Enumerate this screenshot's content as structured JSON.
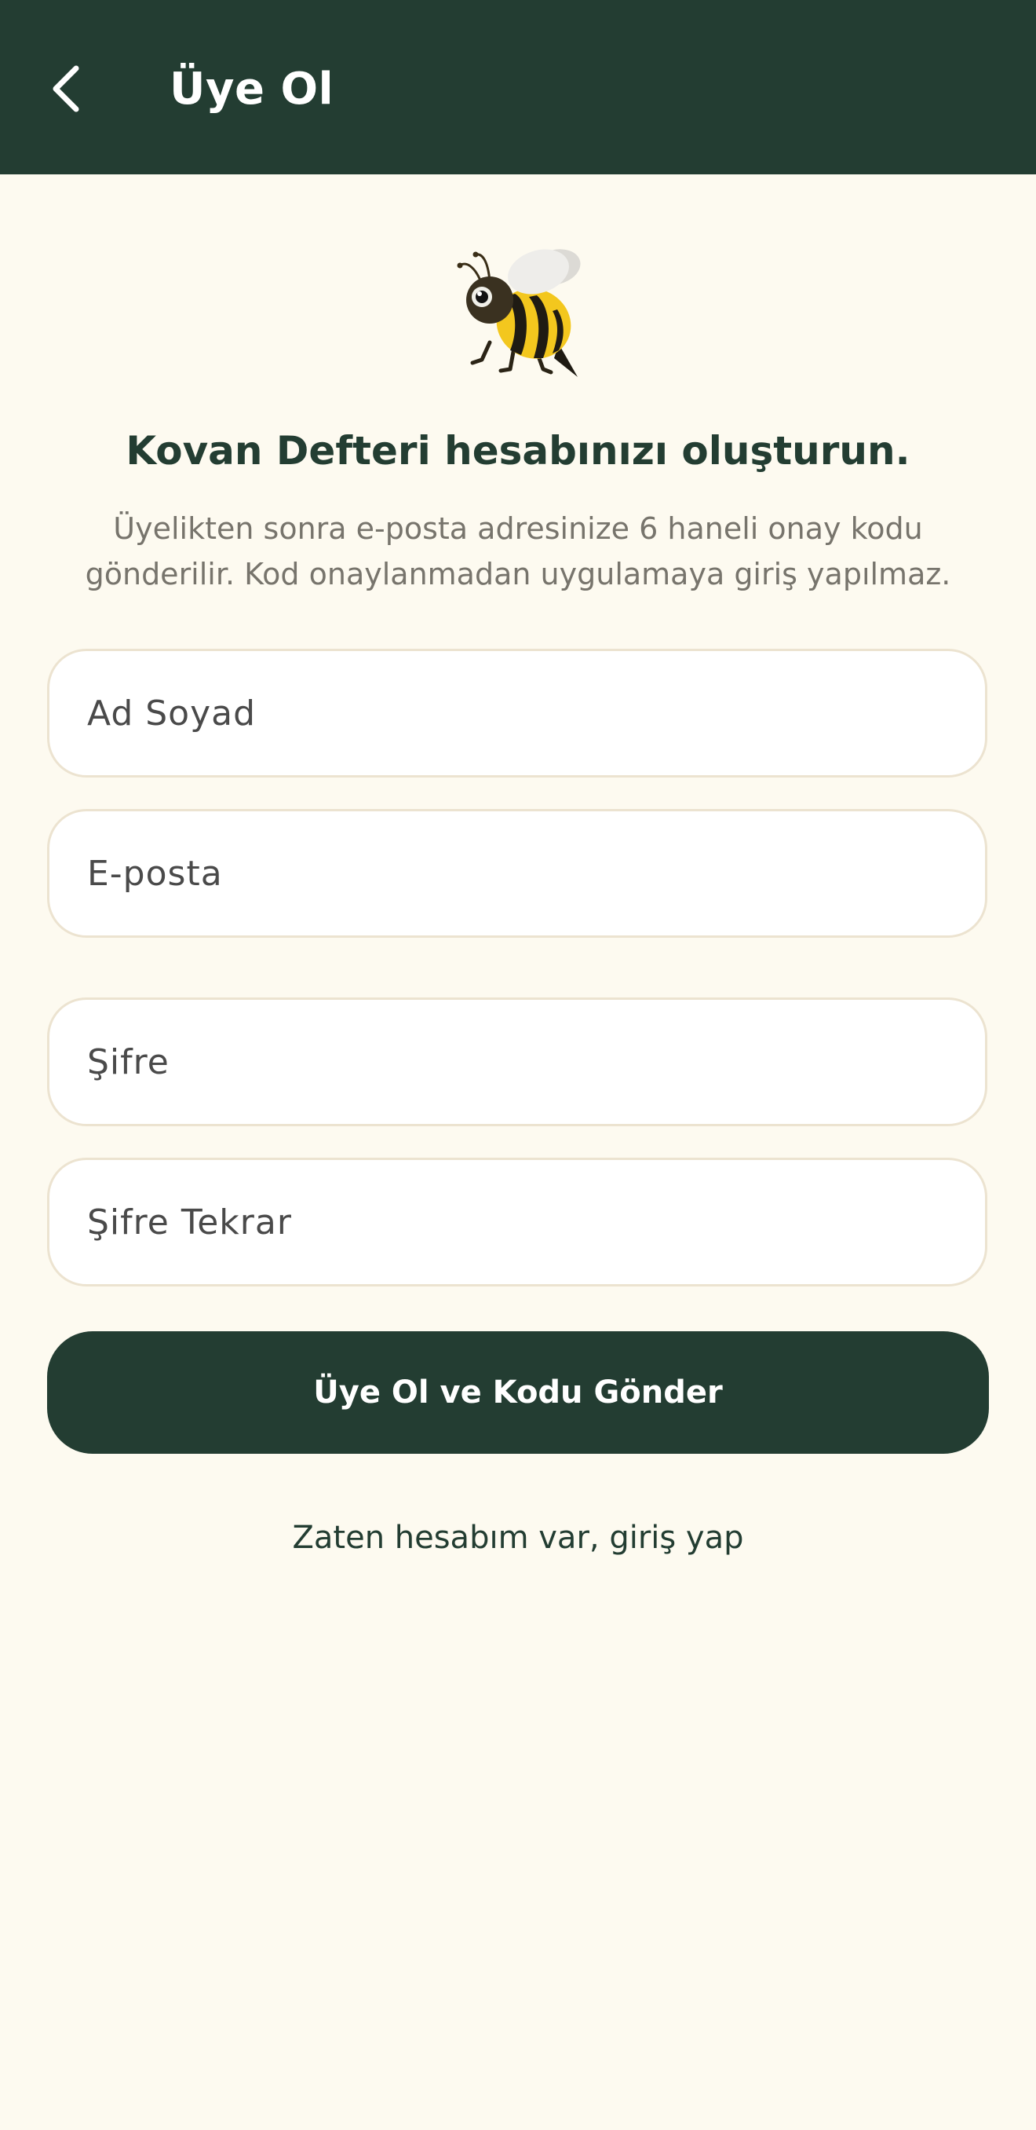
{
  "header": {
    "title": "Üye Ol",
    "back_icon": "chevron-left-icon"
  },
  "hero": {
    "icon": "bee-icon",
    "headline": "Kovan Defteri hesabınızı oluşturun.",
    "description": "Üyelikten sonra e-posta adresinize 6 haneli onay kodu gönderilir. Kod onaylanmadan uygulamaya giriş yapılmaz."
  },
  "form": {
    "name_placeholder": "Ad Soyad",
    "email_placeholder": "E-posta",
    "password_placeholder": "Şifre",
    "password_repeat_placeholder": "Şifre Tekrar",
    "submit_label": "Üye Ol ve Kodu Gönder"
  },
  "footer": {
    "login_link": "Zaten hesabım var, giriş yap"
  },
  "colors": {
    "primary": "#233d32",
    "background": "#fdfaf0",
    "field_border": "#ece3d0",
    "muted_text": "#77746c"
  }
}
